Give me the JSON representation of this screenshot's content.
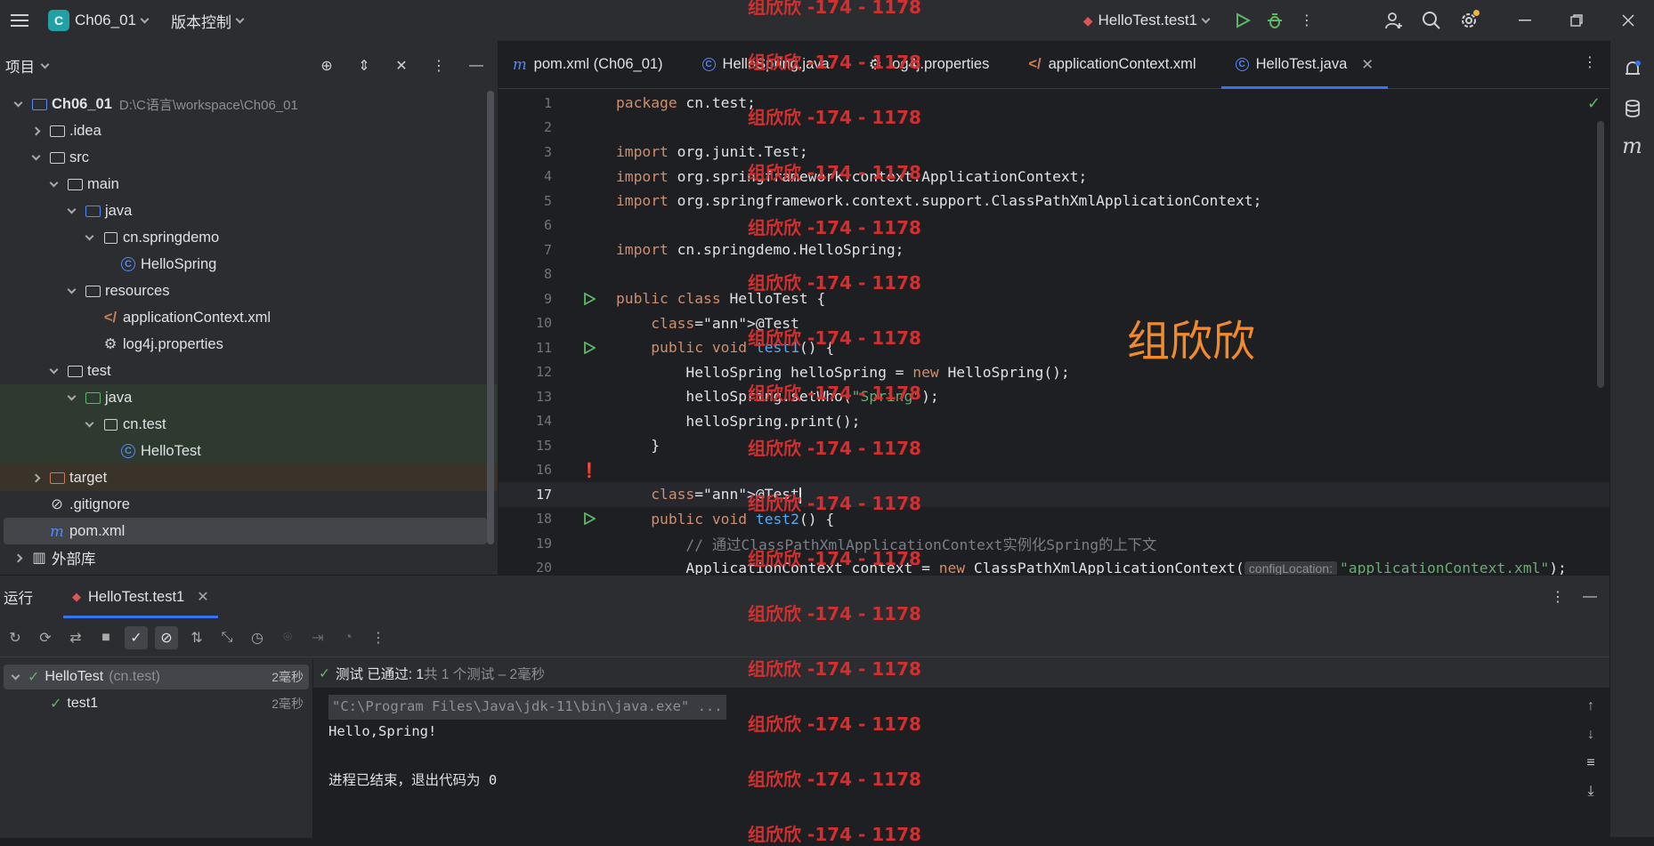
{
  "titlebar": {
    "project_badge": "C",
    "project_name": "Ch06_01",
    "vcs_label": "版本控制",
    "run_config": "HelloTest.test1"
  },
  "project_panel": {
    "title": "项目",
    "tree": [
      {
        "label": "Ch06_01",
        "path": "D:\\C语言\\workspace\\Ch06_01",
        "indent": 0,
        "icon": "module-folder-icon",
        "open": true
      },
      {
        "label": ".idea",
        "indent": 1,
        "icon": "folder-icon",
        "open": false
      },
      {
        "label": "src",
        "indent": 1,
        "icon": "folder-icon",
        "open": true
      },
      {
        "label": "main",
        "indent": 2,
        "icon": "folder-icon",
        "open": true
      },
      {
        "label": "java",
        "indent": 3,
        "icon": "source-folder-icon",
        "open": true
      },
      {
        "label": "cn.springdemo",
        "indent": 4,
        "icon": "package-icon",
        "open": true
      },
      {
        "label": "HelloSpring",
        "indent": 5,
        "icon": "class-icon"
      },
      {
        "label": "resources",
        "indent": 3,
        "icon": "resources-folder-icon",
        "open": true
      },
      {
        "label": "applicationContext.xml",
        "indent": 4,
        "icon": "spring-xml-icon"
      },
      {
        "label": "log4j.properties",
        "indent": 4,
        "icon": "gear-icon"
      },
      {
        "label": "test",
        "indent": 2,
        "icon": "folder-icon",
        "open": true
      },
      {
        "label": "java",
        "indent": 3,
        "icon": "test-folder-icon",
        "open": true
      },
      {
        "label": "cn.test",
        "indent": 4,
        "icon": "package-icon",
        "open": true
      },
      {
        "label": "HelloTest",
        "indent": 5,
        "icon": "class-icon"
      },
      {
        "label": "target",
        "indent": 1,
        "icon": "excluded-folder-icon",
        "open": false
      },
      {
        "label": ".gitignore",
        "indent": 1,
        "icon": "ignore-icon"
      },
      {
        "label": "pom.xml",
        "indent": 1,
        "icon": "maven-icon"
      },
      {
        "label": "外部库",
        "indent": 0,
        "icon": "library-icon",
        "open": false
      }
    ]
  },
  "editor": {
    "tabs": [
      {
        "label": "pom.xml (Ch06_01)",
        "icon": "maven-icon"
      },
      {
        "label": "HelloSpring.java",
        "icon": "class-icon"
      },
      {
        "label": "log4j.properties",
        "icon": "gear-icon"
      },
      {
        "label": "applicationContext.xml",
        "icon": "spring-xml-icon"
      },
      {
        "label": "HelloTest.java",
        "icon": "class-icon",
        "active": true
      }
    ],
    "lines": [
      "package cn.test;",
      "",
      "import org.junit.Test;",
      "import org.springframework.context.ApplicationContext;",
      "import org.springframework.context.support.ClassPathXmlApplicationContext;",
      "",
      "import cn.springdemo.HelloSpring;",
      "",
      "public class HelloTest {",
      "    @Test",
      "    public void test1() {",
      "        HelloSpring helloSpring = new HelloSpring();",
      "        helloSpring.setWho(\"Spring\");",
      "        helloSpring.print();",
      "    }",
      "",
      "    @Test",
      "    public void test2() {",
      "        // 通过ClassPathXmlApplicationContext实例化Spring的上下文",
      "        ApplicationContext context = new ClassPathXmlApplicationContext( configLocation: \"applicationContext.xml\");"
    ],
    "param_hint": "configLocation:",
    "overlay_text": "组欣欣"
  },
  "run_panel": {
    "title": "运行",
    "tab_label": "HelloTest.test1",
    "tests": [
      {
        "name": "HelloTest",
        "pkg": "(cn.test)",
        "time": "2毫秒"
      },
      {
        "name": "test1",
        "time": "2毫秒"
      }
    ],
    "status_label": "测试 已通过: 1",
    "status_detail": "共 1 个测试 – 2毫秒",
    "console": [
      "\"C:\\Program Files\\Java\\jdk-11\\bin\\java.exe\" ...",
      "Hello,Spring!",
      "",
      "进程已结束，退出代码为 0"
    ]
  },
  "watermark": "组欣欣 -174 - 1178",
  "colors": {
    "accent": "#3574f0",
    "pass": "#5fb865",
    "watermark": "#d32f2f"
  }
}
